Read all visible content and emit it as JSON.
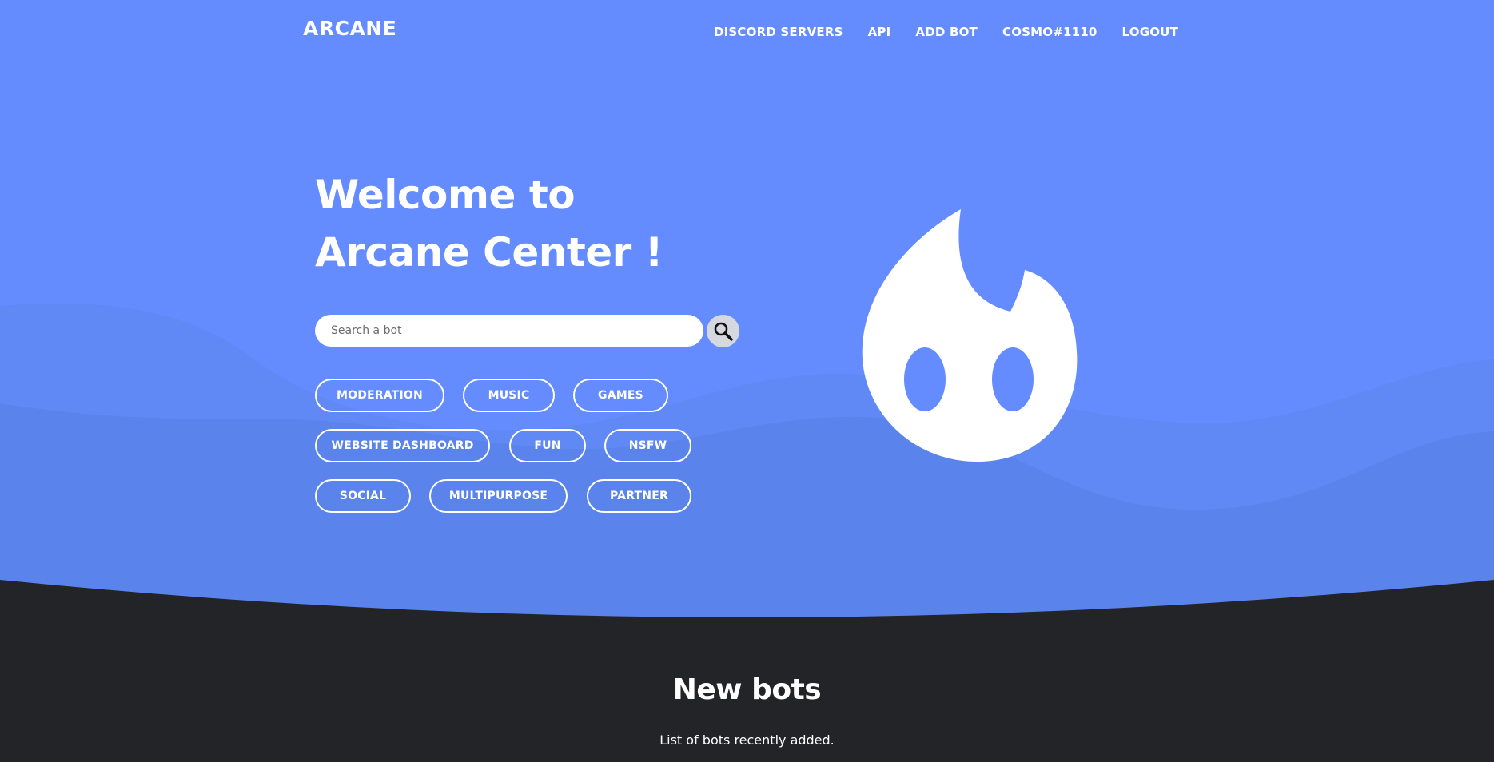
{
  "colors": {
    "hero_bg": "#658cff",
    "wave_light": "#6089f5",
    "wave_mid": "#5a84ec",
    "dark_bg": "#232428",
    "white": "#ffffff"
  },
  "navbar": {
    "brand": "ARCANE",
    "links": [
      "DISCORD SERVERS",
      "API",
      "ADD BOT",
      "COSMO#1110",
      "LOGOUT"
    ]
  },
  "hero": {
    "title_line1": "Welcome to",
    "title_line2": "Arcane Center !",
    "search": {
      "placeholder": "Search a bot",
      "icon": "search-icon"
    },
    "tags": [
      "MODERATION",
      "MUSIC",
      "GAMES",
      "WEBSITE DASHBOARD",
      "FUN",
      "NSFW",
      "SOCIAL",
      "MULTIPURPOSE",
      "PARTNER"
    ],
    "mascot_icon": "flame-mascot-icon"
  },
  "new_bots": {
    "title": "New bots",
    "subtitle": "List of bots recently added."
  }
}
